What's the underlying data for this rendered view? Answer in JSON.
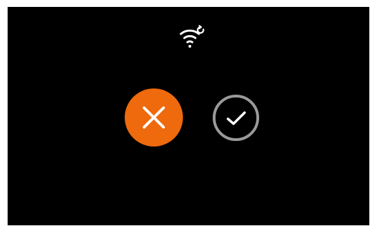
{
  "colors": {
    "screen_background": "#000000",
    "cancel_accent": "#ee6a0c",
    "confirm_ring": "#9a9a9a",
    "icon": "#ffffff"
  },
  "status": {
    "icon": "wifi-reset-icon"
  },
  "actions": {
    "cancel": {
      "icon": "close-icon"
    },
    "confirm": {
      "icon": "check-icon"
    }
  }
}
